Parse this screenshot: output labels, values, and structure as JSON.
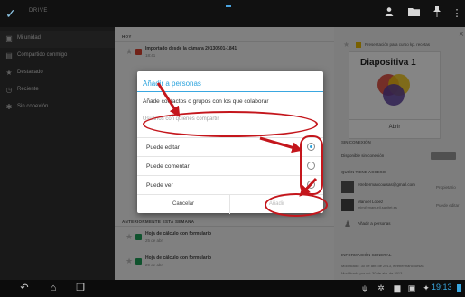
{
  "top_bar": {
    "app_title": "DRIVE",
    "icons": [
      "checkmark-icon",
      "person-icon",
      "folder-icon",
      "pin-icon",
      "overflow-icon"
    ]
  },
  "sidebar": {
    "items": [
      {
        "label": "Mi unidad",
        "icon": "drive-icon",
        "active": true
      },
      {
        "label": "Compartido conmigo",
        "icon": "people-icon",
        "active": false
      },
      {
        "label": "Destacado",
        "icon": "star-icon",
        "active": false
      },
      {
        "label": "Reciente",
        "icon": "clock-icon",
        "active": false
      },
      {
        "label": "Sin conexión",
        "icon": "pin-icon",
        "active": false
      }
    ]
  },
  "list": {
    "sections": [
      {
        "header": "HOY",
        "rows": [
          {
            "title": "Importado desde la cámara 20130501-1841",
            "sub": "18:41",
            "badge_color": "#d9412f"
          }
        ]
      },
      {
        "header": "ANTERIORMENTE ESTA SEMANA",
        "rows": [
          {
            "title": "Hoja de cálculo con formulario",
            "sub": "25 de abr.",
            "badge_color": "#1e9d57"
          },
          {
            "title": "Hoja de cálculo con formulario",
            "sub": "29 de abr.",
            "badge_color": "#1e9d57"
          }
        ]
      }
    ]
  },
  "detail": {
    "file_name": "Presentación para curso kp. recetas",
    "slide_title": "Diapositiva 1",
    "open_label": "Abrir",
    "offline_header": "SIN CONEXIÓN",
    "offline_label": "Disponible sin conexión",
    "access_header": "QUIÉN TIENE ACCESO",
    "people": [
      {
        "name": "etrebermancoursas@gmail.com",
        "role": "Propietario"
      },
      {
        "name": "Manuel López",
        "email": "mlm@manuell.sanitet.es",
        "role": "Puede editar"
      }
    ],
    "add_people": "Añadir a personas",
    "info_header": "INFORMACIÓN GENERAL",
    "modified_1": "Modificado: 30 de abr. de 2013, etrebermancoursas",
    "modified_2": "Modificado por mí: 30 de abr. de 2013"
  },
  "dialog": {
    "title": "Añadir a personas",
    "prompt": "Añade contactos o grupos con los que colaborar",
    "input_placeholder": "Usuarios con quienes compartir",
    "options": [
      {
        "label": "Puede editar",
        "selected": true
      },
      {
        "label": "Puede comentar",
        "selected": false
      },
      {
        "label": "Puede ver",
        "selected": false
      }
    ],
    "cancel_label": "Cancelar",
    "add_label": "Añadir"
  },
  "nav": {
    "icons": [
      "back-icon",
      "home-icon",
      "recent-apps-icon"
    ],
    "status_icons": [
      "usb-icon",
      "settings-icon",
      "gallery-icon",
      "image-icon",
      "pin-icon"
    ],
    "clock": "19:13",
    "battery": "battery-icon"
  },
  "colors": {
    "accent": "#2ba3dd",
    "annotation": "#c4161c"
  }
}
